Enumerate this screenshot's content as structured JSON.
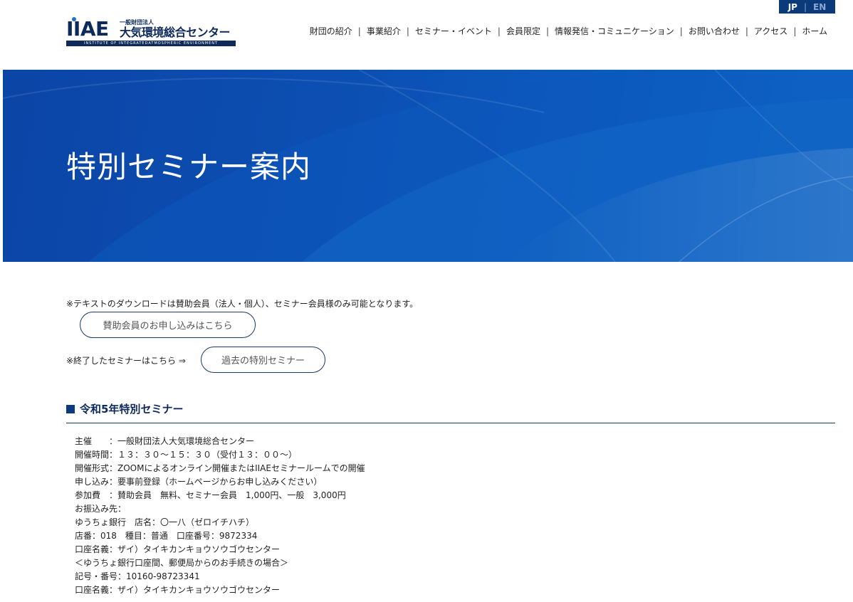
{
  "lang": {
    "jp": "JP",
    "en": "EN"
  },
  "logo": {
    "mark": "IIAE",
    "org_type": "一般財団法人",
    "name": "大気環境総合センター",
    "english": "INSTITUTE OF INTEGRATEDATMOSPHERIC ENVIRONMENT"
  },
  "nav": {
    "items": [
      "財団の紹介",
      "事業紹介",
      "セミナー・イベント",
      "会員限定",
      "情報発信・コミュニケーション",
      "お問い合わせ",
      "アクセス",
      "ホーム"
    ],
    "separator": "|"
  },
  "hero": {
    "title": "特別セミナー案内"
  },
  "content": {
    "note_download": "※テキストのダウンロードは賛助会員（法人・個人）、セミナー会員様のみ可能となります。",
    "btn_apply": "賛助会員のお申し込みはこちら",
    "note_past": "※終了したセミナーはこちら ⇒",
    "btn_past": "過去の特別セミナー"
  },
  "section": {
    "heading": "令和5年特別セミナー"
  },
  "details": [
    "主催　　：一般財団法人大気環境総合センター",
    "開催時間：１３：３０～１５：３０（受付１３：００～）",
    "開催形式：ZOOMによるオンライン開催またはIIAEセミナールームでの開催",
    "申し込み：要事前登録（ホームページからお申し込みください）",
    "参加費　：賛助会員　無料、セミナー会員　1,000円、一般　3,000円",
    "お振込み先：",
    "ゆうちょ銀行　店名：〇一八（ゼロイチハチ）",
    "店番：018　種目：普通　口座番号：9872334",
    "口座名義：ザイ）タイキカンキョウソウゴウセンター",
    "＜ゆうちょ銀行口座間、郵便局からのお手続きの場合＞",
    "記号・番号：10160-98723341",
    "口座名義：ザイ）タイキカンキョウソウゴウセンター"
  ]
}
